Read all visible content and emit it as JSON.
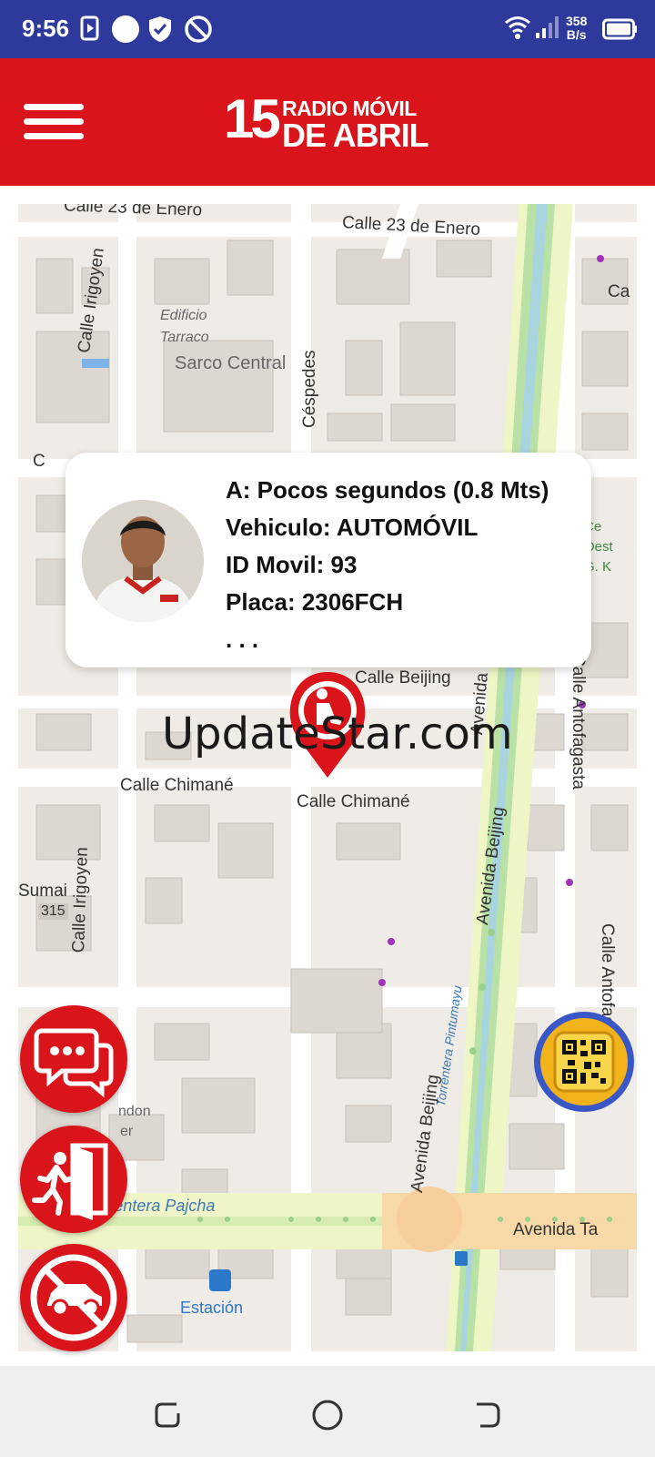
{
  "status_bar": {
    "time": "9:56",
    "net_speed_value": "358",
    "net_speed_unit": "B/s",
    "bg_color": "#2e3a9b"
  },
  "header": {
    "logo_number": "15",
    "logo_line1": "RADIO MÓVIL",
    "logo_line2": "DE ABRIL",
    "brand_color": "#d9141b"
  },
  "map": {
    "labels": {
      "calle_23_enero_1": "Calle 23 de Enero",
      "calle_23_enero_2": "Calle 23 de Enero",
      "calle_irigoyen_top": "Calle Irigoyen",
      "edificio_1": "Edificio",
      "edificio_2": "Tarraco",
      "sarco_central": "Sarco Central",
      "cespedes": "Céspedes",
      "calle_beijing": "Calle Beijing",
      "avenida_beijing_top": "Avenida Beijing",
      "calle_antofagasta": "Calle Antofagasta",
      "calle_chimane_1": "Calle Chimané",
      "calle_chimane_2": "Calle Chimané",
      "avenida_beijing_mid": "Avenida Beijing",
      "calle_irigoyen_bottom": "Calle Irigoyen",
      "sumai": "Sumai",
      "route_315": "315",
      "torrentera_pintumayu": "Torrentera Pintumayu",
      "avenida_beijing_bottom": "Avenida Beijing",
      "calle_antofagasta_bottom": "Calle Antofagasta",
      "torrentera_pajcha": "Torrentera Pajcha",
      "avenida_ta": "Avenida Ta",
      "estacion": "Estación",
      "right_edge_ca": "Ca",
      "oeste_1": "Ce",
      "oeste_2": "Oest",
      "oeste_3": "G. K",
      "right_edge_c": "C",
      "donde_1": "ndon",
      "donde_2": "er"
    }
  },
  "info_card": {
    "arrival": "A: Pocos segundos (0.8 Mts)",
    "vehicle": "Vehiculo: AUTOMÓVIL",
    "movil_id": "ID Movil: 93",
    "plate": "Placa: 2306FCH",
    "more": ". . ."
  },
  "watermark": "UpdateStar.com",
  "icons": {
    "chat": "chat-bubbles-icon",
    "exit": "exit-door-icon",
    "cancel": "cancel-car-icon",
    "qr": "qr-code-icon",
    "marker": "car-location-marker-icon"
  }
}
